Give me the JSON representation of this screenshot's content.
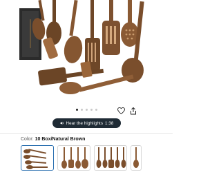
{
  "product": {
    "image_alt": "Set of wooden cooking utensils in a gift box",
    "image_count": 5,
    "active_image": 1
  },
  "actions": {
    "favorite_icon": "heart-icon",
    "share_icon": "share-icon"
  },
  "highlights": {
    "label": "Hear the highlights",
    "duration": "1:38",
    "icon": "speaker-icon"
  },
  "variant": {
    "label": "Color:",
    "value": "10 Box/Natural Brown"
  },
  "colors": {
    "wood_dark": "#6b4526",
    "wood_mid": "#8a5a34",
    "wood_light": "#a9744a",
    "box": "#2b2b2b",
    "pill_bg": "#1f2b35",
    "selected_border": "#2a6fb0"
  }
}
